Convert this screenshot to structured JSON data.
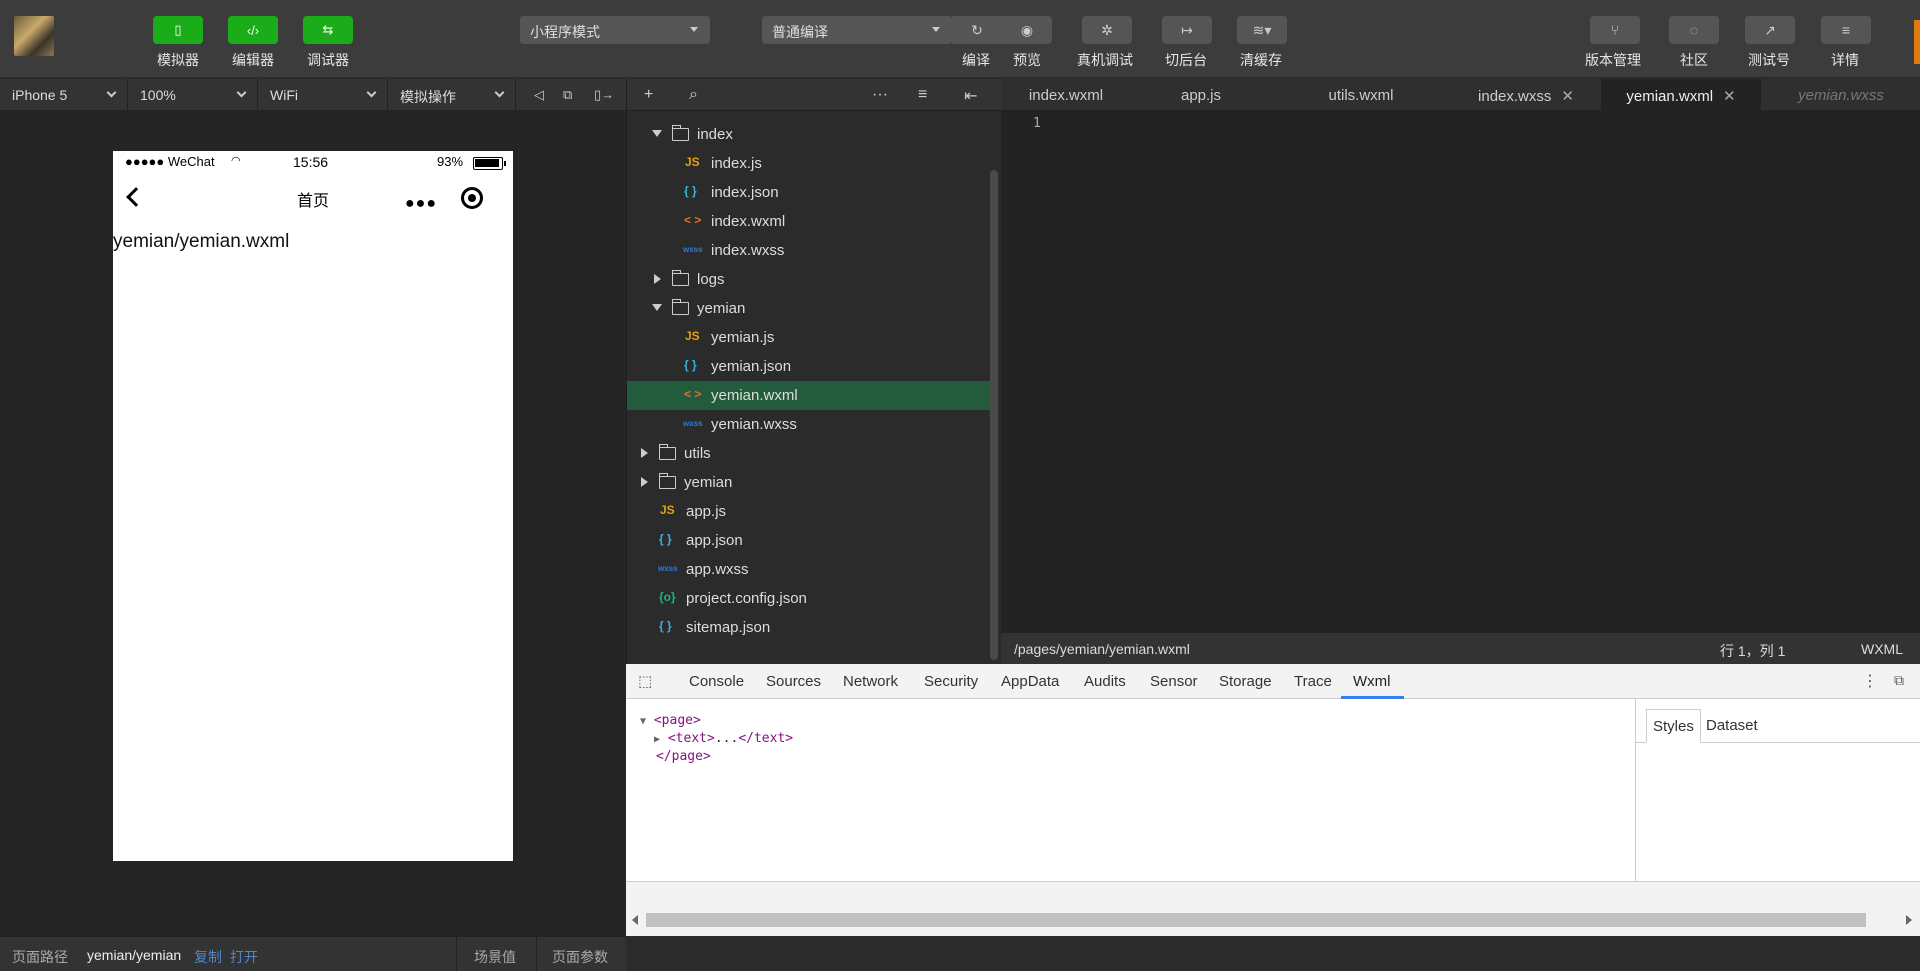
{
  "toolbar": {
    "simulator": "模拟器",
    "editor": "编辑器",
    "debugger": "调试器",
    "mode": "小程序模式",
    "compile_mode": "普通编译",
    "compile": "编译",
    "preview": "预览",
    "remote_debug": "真机调试",
    "background": "切后台",
    "clear_cache": "清缓存",
    "version": "版本管理",
    "community": "社区",
    "test_account": "测试号",
    "details": "详情"
  },
  "simbar": {
    "device": "iPhone 5",
    "zoom": "100%",
    "network": "WiFi",
    "operation": "模拟操作"
  },
  "phone": {
    "signal": "●●●●● WeChat",
    "time": "15:56",
    "battery": "93%",
    "nav_title": "首页",
    "content": "yemian/yemian.wxml"
  },
  "simfoot": {
    "path_label": "页面路径",
    "path": "yemian/yemian",
    "copy": "复制",
    "open": "打开",
    "scene": "场景值",
    "params": "页面参数"
  },
  "explorer": {
    "rows": [
      {
        "name": "index"
      },
      {
        "name": "index.js",
        "type": "JS"
      },
      {
        "name": "index.json",
        "type": "{ }"
      },
      {
        "name": "index.wxml",
        "type": "< >"
      },
      {
        "name": "index.wxss",
        "type": "wxss"
      },
      {
        "name": "logs"
      },
      {
        "name": "yemian"
      },
      {
        "name": "yemian.js",
        "type": "JS"
      },
      {
        "name": "yemian.json",
        "type": "{ }"
      },
      {
        "name": "yemian.wxml",
        "type": "< >"
      },
      {
        "name": "yemian.wxss",
        "type": "wxss"
      },
      {
        "name": "utils"
      },
      {
        "name": "yemian"
      },
      {
        "name": "app.js",
        "type": "JS"
      },
      {
        "name": "app.json",
        "type": "{ }"
      },
      {
        "name": "app.wxss",
        "type": "wxss"
      },
      {
        "name": "project.config.json",
        "type": "{o}"
      },
      {
        "name": "sitemap.json",
        "type": "{ }"
      }
    ]
  },
  "tabs": {
    "t1": "index.wxml",
    "t2": "app.js",
    "t3": "utils.wxml",
    "t4": "index.wxss",
    "t5": "yemian.wxml",
    "t6": "yemian.wxss"
  },
  "editor": {
    "line1": "1",
    "path": "/pages/yemian/yemian.wxml",
    "cursor": "行 1，列 1",
    "lang": "WXML"
  },
  "devtools": {
    "tabs": [
      "Console",
      "Sources",
      "Network",
      "Security",
      "AppData",
      "Audits",
      "Sensor",
      "Storage",
      "Trace",
      "Wxml"
    ],
    "xml_open": "<page>",
    "xml_child_open": "<text>",
    "xml_ellipsis": "...",
    "xml_child_close": "</text>",
    "xml_close": "</page>",
    "side_styles": "Styles",
    "side_dataset": "Dataset"
  },
  "colors": {
    "accent_green": "#1aad19",
    "selection": "#225c3c",
    "devtools_active": "#3a7ff2"
  }
}
